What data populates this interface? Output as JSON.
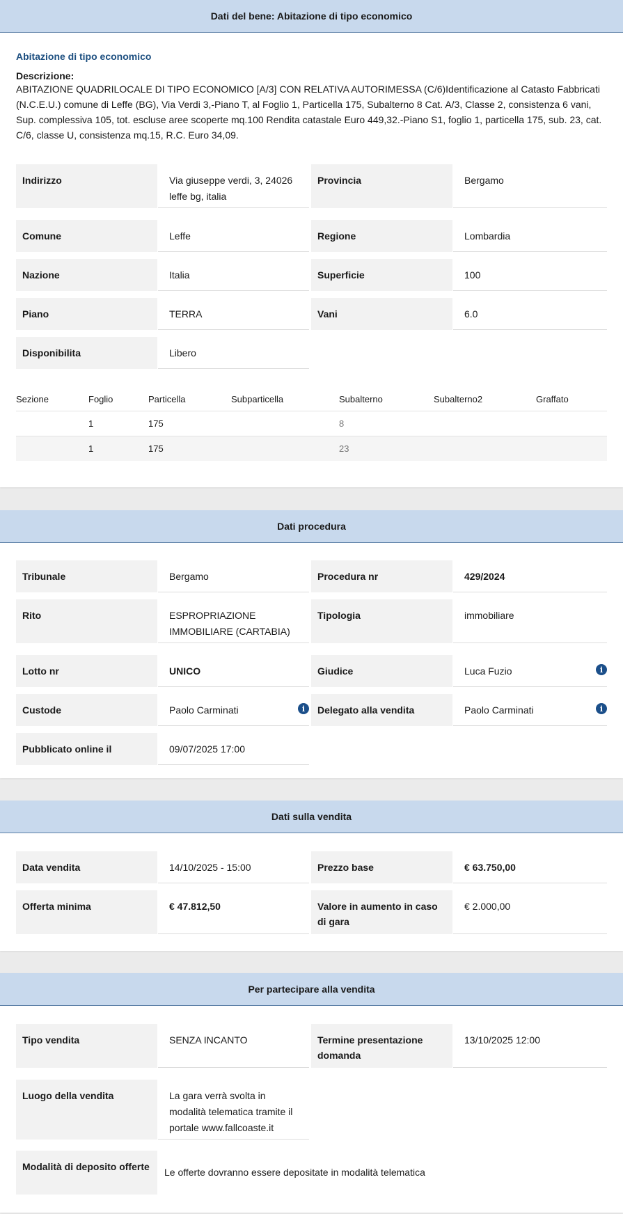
{
  "bene": {
    "header": "Dati del bene: Abitazione di tipo economico",
    "subtitle": "Abitazione di tipo economico",
    "desc_label": "Descrizione:",
    "desc_text": "ABITAZIONE QUADRILOCALE DI TIPO ECONOMICO [A/3] CON RELATIVA AUTORIMESSA (C/6)Identificazione al Catasto Fabbricati (N.C.E.U.) comune di Leffe (BG), Via Verdi 3,-Piano T, al Foglio 1, Particella 175, Subalterno 8 Cat. A/3, Classe 2, consistenza 6 vani, Sup. complessiva 105, tot. escluse aree scoperte mq.100 Rendita catastale Euro 449,32.-Piano S1, foglio 1, particella 175, sub. 23, cat. C/6, classe U, consistenza mq.15, R.C. Euro 34,09.",
    "fields": {
      "indirizzo_label": "Indirizzo",
      "indirizzo_value": "Via giuseppe verdi, 3, 24026 leffe bg, italia",
      "provincia_label": "Provincia",
      "provincia_value": "Bergamo",
      "comune_label": "Comune",
      "comune_value": "Leffe",
      "regione_label": "Regione",
      "regione_value": "Lombardia",
      "nazione_label": "Nazione",
      "nazione_value": "Italia",
      "superficie_label": "Superficie",
      "superficie_value": "100",
      "piano_label": "Piano",
      "piano_value": "TERRA",
      "vani_label": "Vani",
      "vani_value": "6.0",
      "disponibilita_label": "Disponibilita",
      "disponibilita_value": "Libero"
    },
    "catasto": {
      "headers": [
        "Sezione",
        "Foglio",
        "Particella",
        "Subparticella",
        "Subalterno",
        "Subalterno2",
        "Graffato"
      ],
      "rows": [
        [
          "",
          "1",
          "175",
          "",
          "8",
          "",
          ""
        ],
        [
          "",
          "1",
          "175",
          "",
          "23",
          "",
          ""
        ]
      ]
    }
  },
  "procedura": {
    "header": "Dati procedura",
    "tribunale_label": "Tribunale",
    "tribunale_value": "Bergamo",
    "procedura_label": "Procedura nr",
    "procedura_value": "429/2024",
    "rito_label": "Rito",
    "rito_value": "ESPROPRIAZIONE IMMOBILIARE (CARTABIA)",
    "tipologia_label": "Tipologia",
    "tipologia_value": "immobiliare",
    "lotto_label": "Lotto nr",
    "lotto_value": "UNICO",
    "giudice_label": "Giudice",
    "giudice_value": "Luca Fuzio",
    "custode_label": "Custode",
    "custode_value": "Paolo Carminati",
    "delegato_label": "Delegato alla vendita",
    "delegato_value": "Paolo Carminati",
    "pubblicato_label": "Pubblicato online il",
    "pubblicato_value": "09/07/2025 17:00",
    "info_glyph": "i"
  },
  "vendita": {
    "header": "Dati sulla vendita",
    "data_label": "Data vendita",
    "data_value": "14/10/2025 - 15:00",
    "prezzo_label": "Prezzo base",
    "prezzo_value": "€ 63.750,00",
    "offerta_label": "Offerta minima",
    "offerta_value": "€ 47.812,50",
    "aumento_label": "Valore in aumento in caso di gara",
    "aumento_value": "€ 2.000,00"
  },
  "partecipare": {
    "header": "Per partecipare alla vendita",
    "tipo_label": "Tipo vendita",
    "tipo_value": "SENZA INCANTO",
    "termine_label": "Termine presentazione domanda",
    "termine_value": "13/10/2025 12:00",
    "luogo_label": "Luogo della vendita",
    "luogo_value": "La gara verrà svolta in modalità telematica tramite il portale www.fallcoaste.it",
    "modalita_label": "Modalità di deposito offerte",
    "modalita_value": "Le offerte dovranno essere depositate in modalità telematica"
  }
}
